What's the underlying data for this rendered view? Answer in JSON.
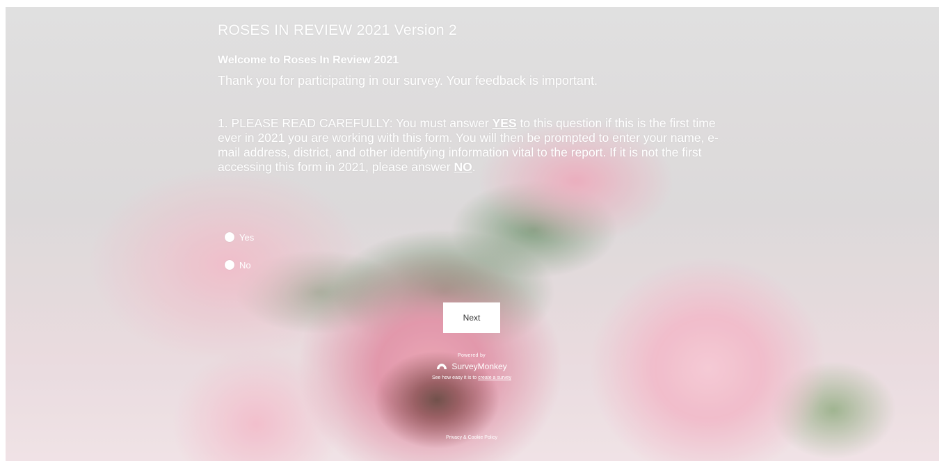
{
  "survey": {
    "title": "ROSES IN REVIEW 2021 Version 2",
    "page_title": "Welcome to Roses In Review 2021",
    "page_description": "Thank you for participating in our survey. Your feedback is important."
  },
  "question": {
    "text_part1": "1. PLEASE READ CAREFULLY: You must answer ",
    "emphasis_yes": "YES",
    "text_part2": " to this question if this is the first time ever in 2021 you are working with this form. You will then be prompted to enter your name, e-mail address, district, and other identifying information vital to the report. If it is not the first accessing this form in 2021, please answer ",
    "emphasis_no": "NO",
    "text_part3": ".",
    "options": [
      {
        "label": "Yes"
      },
      {
        "label": "No"
      }
    ]
  },
  "navigation": {
    "next_label": "Next"
  },
  "footer": {
    "powered_by": "Powered by",
    "brand": "SurveyMonkey",
    "create_prefix": "See how easy it is to ",
    "create_link": "create a survey",
    "privacy": "Privacy & Cookie Policy"
  },
  "colors": {
    "text": "#ffffff",
    "button_bg": "#ffffff",
    "button_text": "#333333"
  }
}
